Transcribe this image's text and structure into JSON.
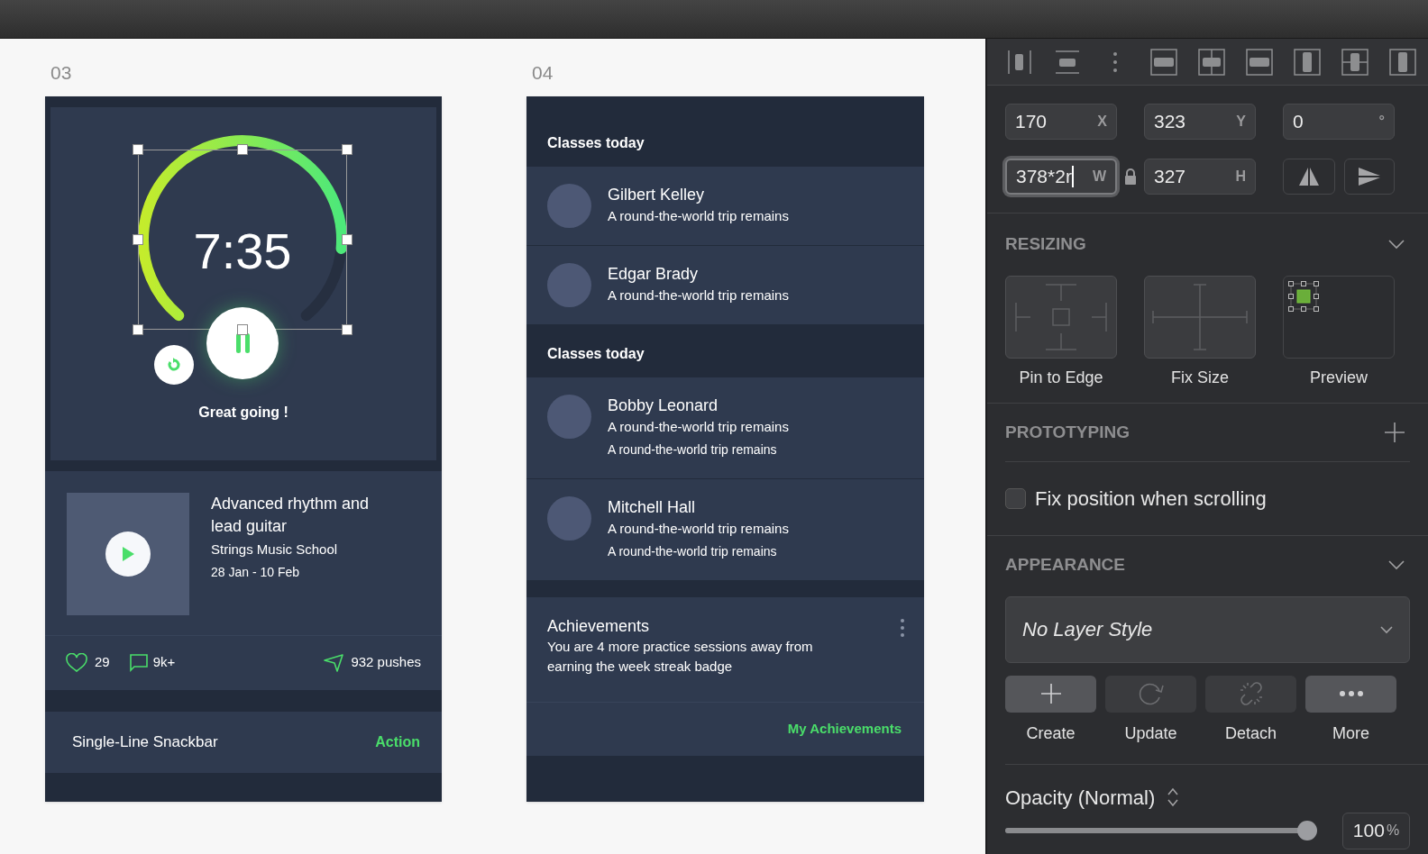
{
  "artboards": [
    {
      "kind": "timer",
      "label": "03",
      "timer": {
        "time": "7:35",
        "message": "Great going !"
      },
      "course": {
        "title": "Advanced rhythm and lead guitar",
        "school": "Strings Music School",
        "dates": "28 Jan - 10 Feb"
      },
      "stats": {
        "likes": "29",
        "comments": "9k+",
        "pushes": "932 pushes"
      },
      "snackbar": {
        "text": "Single-Line Snackbar",
        "action": "Action"
      }
    },
    {
      "kind": "classes",
      "label": "04",
      "sections": [
        {
          "title": "Classes today",
          "items": [
            {
              "name": "Gilbert Kelley",
              "lines": [
                "A round-the-world trip remains"
              ]
            },
            {
              "name": "Edgar Brady",
              "lines": [
                "A round-the-world trip remains"
              ]
            }
          ]
        },
        {
          "title": "Classes today",
          "items": [
            {
              "name": "Bobby Leonard",
              "lines": [
                "A round-the-world trip remains",
                "A round-the-world trip remains"
              ]
            },
            {
              "name": "Mitchell Hall",
              "lines": [
                "A round-the-world trip remains",
                "A round-the-world trip remains"
              ]
            }
          ]
        }
      ],
      "achievement": {
        "title": "Achievements",
        "text": "You are 4 more practice sessions away from earning the week streak badge",
        "link": "My Achievements"
      }
    }
  ],
  "inspector": {
    "fields": [
      {
        "value": "170",
        "suffix": "X",
        "focused": false
      },
      {
        "value": "323",
        "suffix": "Y",
        "focused": false
      },
      {
        "value": "0",
        "suffix": "°",
        "focused": false
      },
      {
        "value": "378*2r",
        "suffix": "W",
        "focused": true
      },
      {
        "value": "327",
        "suffix": "H",
        "focused": false
      }
    ],
    "resizing": {
      "title": "RESIZING",
      "expanded": true,
      "options": [
        {
          "kind": "pin",
          "label": "Pin to Edge"
        },
        {
          "kind": "fix",
          "label": "Fix Size"
        },
        {
          "kind": "preview",
          "label": "Preview"
        }
      ]
    },
    "prototyping": {
      "title": "PROTOTYPING",
      "option": {
        "label": "Fix position when scrolling",
        "checked": false
      }
    },
    "appearance": {
      "title": "APPEARANCE",
      "expanded": true,
      "style": "No Layer Style",
      "actions": [
        {
          "kind": "create",
          "label": "Create",
          "disabled": false
        },
        {
          "kind": "update",
          "label": "Update",
          "disabled": true
        },
        {
          "kind": "detach",
          "label": "Detach",
          "disabled": true
        },
        {
          "kind": "more",
          "label": "More",
          "disabled": false
        }
      ]
    },
    "opacity": {
      "label": "Opacity (Normal)",
      "level": 1,
      "value": "100",
      "unit": "%"
    }
  }
}
